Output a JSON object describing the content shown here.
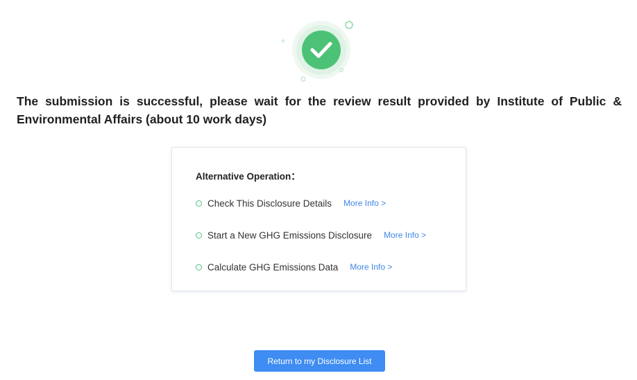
{
  "message": "The submission is successful, please wait for the review result provided by Institute of Public & Environmental Affairs (about 10 work days)",
  "operations": {
    "title": "Alternative Operation：",
    "items": [
      {
        "label": "Check This Disclosure Details",
        "link": "More Info >"
      },
      {
        "label": "Start a New GHG Emissions Disclosure",
        "link": "More Info >"
      },
      {
        "label": "Calculate GHG Emissions Data",
        "link": "More Info >"
      }
    ]
  },
  "return_button": {
    "label": "Return to my Disclosure List"
  },
  "icons": {
    "success": "check-circle-icon",
    "bullet": "circle-outline-icon"
  },
  "colors": {
    "success_green": "#52c27a",
    "link_blue": "#3f86e6",
    "button_blue": "#3f8cf2"
  }
}
